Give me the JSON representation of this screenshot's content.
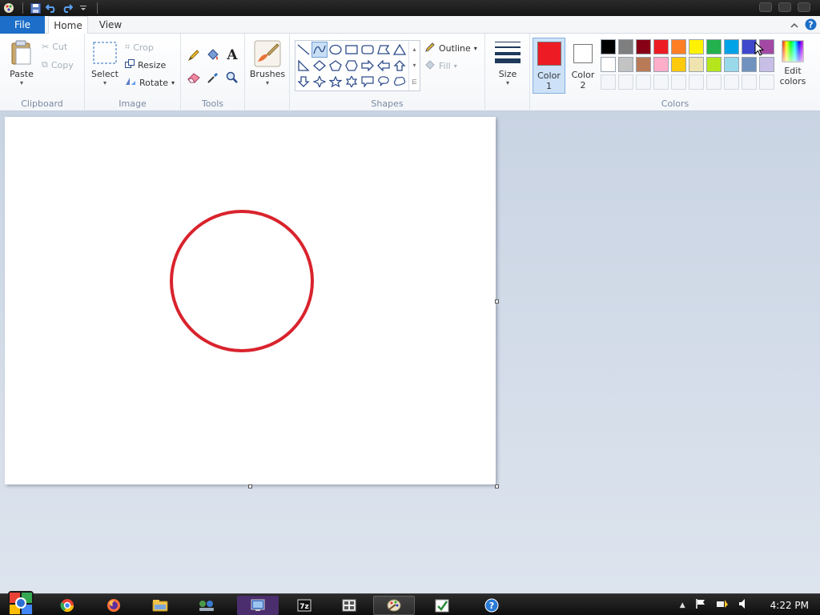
{
  "window": {
    "quick_access": [
      {
        "name": "paint-app-icon"
      },
      {
        "name": "save-icon"
      },
      {
        "name": "undo-icon"
      },
      {
        "name": "redo-icon"
      },
      {
        "name": "customize-qat-icon"
      }
    ]
  },
  "tabs": {
    "file": "File",
    "home": "Home",
    "view": "View"
  },
  "ribbon": {
    "clipboard": {
      "label": "Clipboard",
      "paste": "Paste",
      "cut": "Cut",
      "copy": "Copy"
    },
    "image": {
      "label": "Image",
      "select": "Select",
      "crop": "Crop",
      "resize": "Resize",
      "rotate": "Rotate"
    },
    "tools": {
      "label": "Tools"
    },
    "brushes": {
      "label": "Brushes"
    },
    "shapes": {
      "label": "Shapes",
      "outline": "Outline",
      "fill": "Fill",
      "selected_shape": "curve"
    },
    "size": {
      "label": "Size"
    },
    "colors": {
      "label": "Colors",
      "color1_line1": "Color",
      "color1_line2": "1",
      "color2_line1": "Color",
      "color2_line2": "2",
      "edit_line1": "Edit",
      "edit_line2": "colors",
      "color1_value": "#ed1c24",
      "color2_value": "#ffffff",
      "palette_row1": [
        "#000000",
        "#7f7f7f",
        "#880015",
        "#ed1c24",
        "#ff7f27",
        "#fff200",
        "#22b14c",
        "#00a2e8",
        "#3f48cc",
        "#a349a4"
      ],
      "palette_row2": [
        "#ffffff",
        "#c3c3c3",
        "#b97a57",
        "#ffaec9",
        "#ffc90e",
        "#efe4b0",
        "#b5e61d",
        "#99d9ea",
        "#7092be",
        "#c8bfe7"
      ]
    }
  },
  "canvas": {
    "drawn_shape": "circle",
    "stroke_color": "#d9232d"
  },
  "taskbar": {
    "items": [
      "start-button",
      "chrome-icon",
      "firefox-icon",
      "file-explorer-icon",
      "network-icon",
      "remote-desktop-icon",
      "seven-zip-icon",
      "app-grid-icon",
      "paint-icon",
      "tasks-icon",
      "help-icon"
    ],
    "clock": "4:22 PM"
  }
}
